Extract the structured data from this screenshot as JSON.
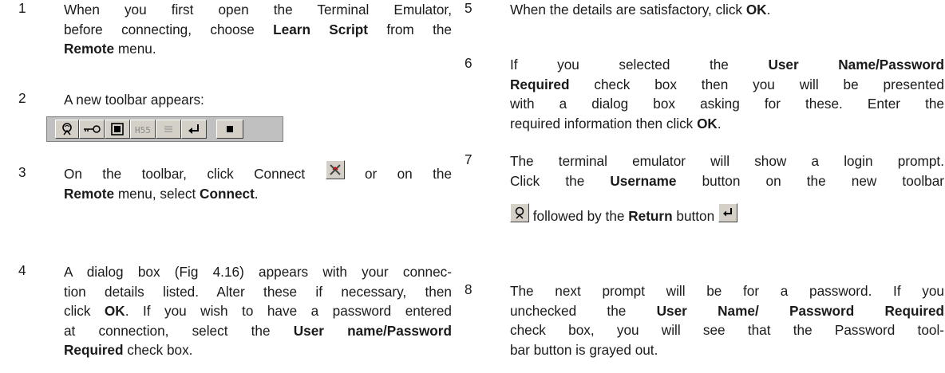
{
  "steps": {
    "s1": {
      "num": "1",
      "l1": "When you first open the Terminal Emulator,",
      "l2a": "before connecting, choose ",
      "l2b": "Learn Script",
      "l2c": " from the",
      "l3a": "Remote",
      "l3b": " menu."
    },
    "s2": {
      "num": "2",
      "l1": "A new toolbar appears:"
    },
    "s3": {
      "num": "3",
      "l1a": "On the toolbar, click Connect",
      "l1b": "or on the",
      "l2a": "Remote",
      "l2b": " menu, select ",
      "l2c": "Connect",
      "l2d": "."
    },
    "s4": {
      "num": "4",
      "l1": "A dialog box (Fig 4.16) appears with your connec-",
      "l2": "tion details listed. Alter these if necessary, then",
      "l3a": "click ",
      "l3b": "OK",
      "l3c": ". If you wish to have a password entered",
      "l4a": "at connection, select the ",
      "l4b": "User name/Password",
      "l5a": "Required",
      "l5b": " check box."
    },
    "s5": {
      "num": "5",
      "l1a": "When the details are satisfactory, click ",
      "l1b": "OK",
      "l1c": "."
    },
    "s6": {
      "num": "6",
      "l1a": "If you selected the ",
      "l1b": "User Name/Password",
      "l2a": "Required",
      "l2b": " check box then you will be presented",
      "l3": "with a dialog box asking for these. Enter the",
      "l4a": "required information then click ",
      "l4b": "OK",
      "l4c": "."
    },
    "s7": {
      "num": "7",
      "l1": "The terminal emulator will show a login prompt.",
      "l2a": "Click the ",
      "l2b": "Username",
      "l2c": " button on the new toolbar",
      "l3a": " followed by the ",
      "l3b": "Return",
      "l3c": " button"
    },
    "s8": {
      "num": "8",
      "l1": "The next prompt will be for a password. If you",
      "l2a": "unchecked the ",
      "l2b": "User Name/ Password Required",
      "l3": "check box, you will see that the Password tool-",
      "l4": "bar button is grayed out."
    }
  },
  "toolbar": {
    "buttons": [
      "username-icon",
      "password-icon",
      "id-icon",
      "hss-icon",
      "list-icon",
      "return-icon",
      "stop-icon"
    ]
  },
  "colors": {
    "text": "#1a1a1a",
    "toolbar_bg": "#c0c0c0",
    "button_face": "#d4d0c8"
  }
}
